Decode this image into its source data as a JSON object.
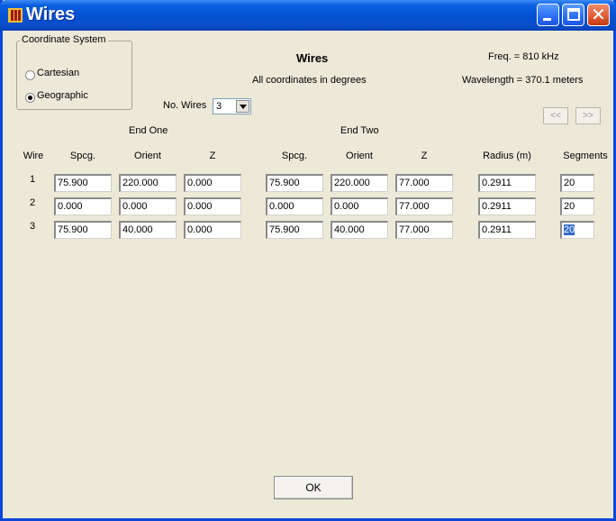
{
  "window": {
    "title": "Wires"
  },
  "coord_system": {
    "legend": "Coordinate System",
    "options": [
      {
        "label": "Cartesian",
        "selected": false
      },
      {
        "label": "Geographic",
        "selected": true
      }
    ]
  },
  "header": {
    "title": "Wires",
    "subtitle": "All coordinates in degrees",
    "freq": "Freq. = 810 kHz",
    "wavelength": "Wavelength = 370.1 meters"
  },
  "no_wires": {
    "label": "No. Wires",
    "value": "3"
  },
  "nav": {
    "prev": "<<",
    "next": ">>"
  },
  "group_headers": {
    "end_one": "End One",
    "end_two": "End Two"
  },
  "columns": [
    "Wire",
    "Spcg.",
    "Orient",
    "Z",
    "Spcg.",
    "Orient",
    "Z",
    "Radius (m)",
    "Segments"
  ],
  "rows": [
    {
      "wire": "1",
      "cells": [
        "75.900",
        "220.000",
        "0.000",
        "75.900",
        "220.000",
        "77.000",
        "0.2911",
        "20"
      ]
    },
    {
      "wire": "2",
      "cells": [
        "0.000",
        "0.000",
        "0.000",
        "0.000",
        "0.000",
        "77.000",
        "0.2911",
        "20"
      ]
    },
    {
      "wire": "3",
      "cells": [
        "75.900",
        "40.000",
        "0.000",
        "75.900",
        "40.000",
        "77.000",
        "0.2911",
        "20"
      ]
    }
  ],
  "ok_label": "OK"
}
